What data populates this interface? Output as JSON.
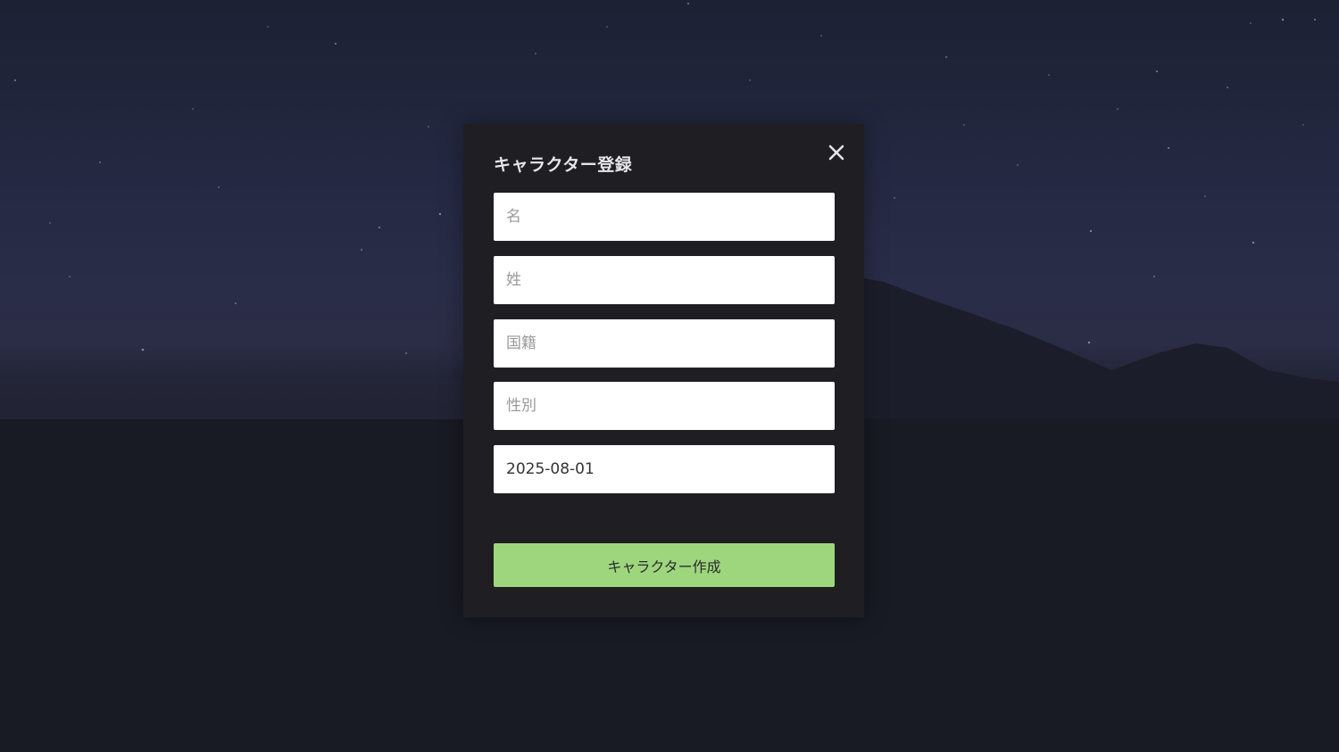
{
  "modal": {
    "title": "キャラクター登録",
    "close_icon": "close-icon",
    "fields": {
      "first_name": {
        "placeholder": "名",
        "value": ""
      },
      "last_name": {
        "placeholder": "姓",
        "value": ""
      },
      "nationality": {
        "placeholder": "国籍",
        "value": ""
      },
      "gender": {
        "placeholder": "性別",
        "value": ""
      },
      "birthdate": {
        "value": "2025-08-01"
      }
    },
    "submit_label": "キャラクター作成"
  },
  "colors": {
    "modal_bg": "#1f1e22",
    "button_green": "#9ed67e",
    "title_text": "#e6e6e8"
  }
}
